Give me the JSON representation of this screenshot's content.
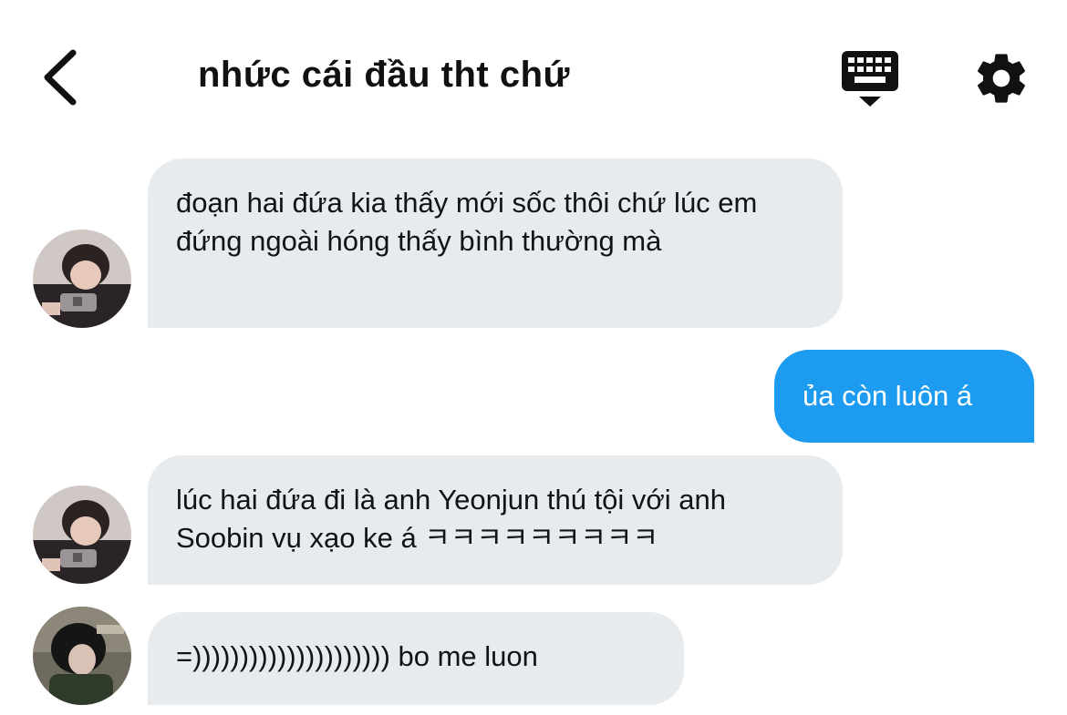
{
  "header": {
    "title": "nhức cái đầu tht chứ",
    "icons": {
      "back": "chevron-left-icon",
      "keyboard": "keyboard-icon",
      "settings": "gear-icon"
    }
  },
  "messages": [
    {
      "direction": "incoming",
      "text": "đoạn hai đứa kia thấy mới sốc thôi chứ lúc em đứng ngoài hóng thấy bình thường mà"
    },
    {
      "direction": "outgoing",
      "text": "ủa còn luôn á"
    },
    {
      "direction": "incoming",
      "text": "lúc hai đứa đi là anh Yeonjun thú tội với anh Soobin vụ xạo ke á ㅋㅋㅋㅋㅋㅋㅋㅋㅋ"
    },
    {
      "direction": "incoming",
      "text": "=))))))))))))))))))))) bo me luon"
    }
  ],
  "colors": {
    "incoming_bubble": "#e7ebee",
    "outgoing_bubble": "#1d9bf0",
    "text": "#0f1419"
  }
}
